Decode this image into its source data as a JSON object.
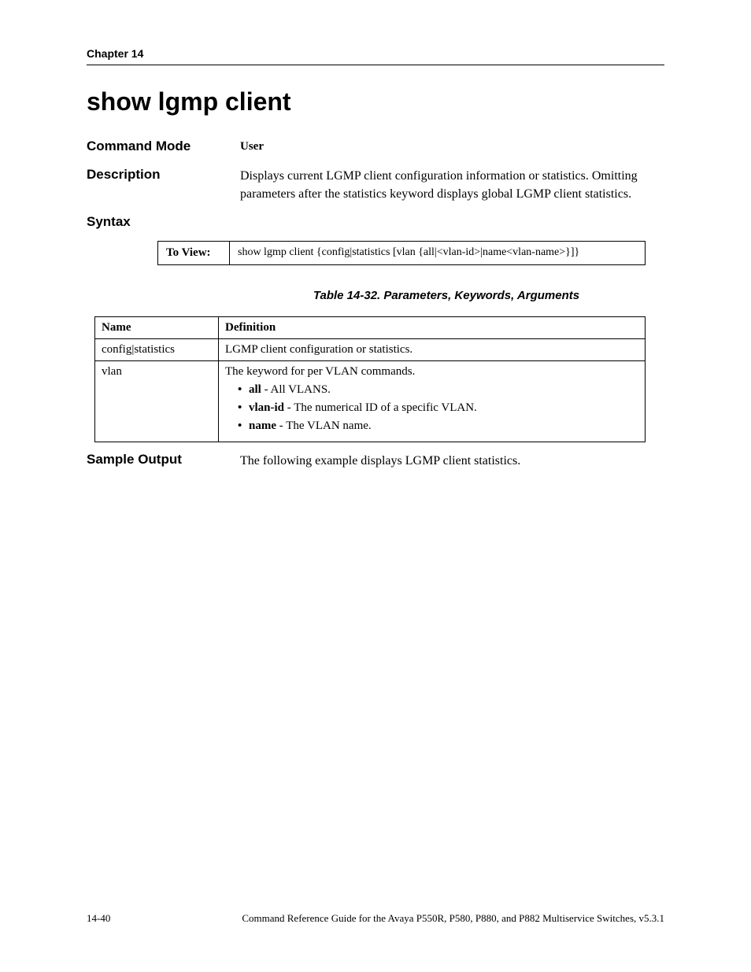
{
  "header": {
    "chapter": "Chapter 14"
  },
  "title": "show lgmp client",
  "command_mode": {
    "label": "Command Mode",
    "value": "User"
  },
  "description": {
    "label": "Description",
    "text": "Displays current LGMP client configuration information or statistics. Omitting parameters after the statistics keyword displays global LGMP client statistics."
  },
  "syntax": {
    "label": "Syntax",
    "row_label": "To View:",
    "command": "show lgmp client {config|statistics [vlan {all|<vlan-id>|name<vlan-name>}]}"
  },
  "table_caption": "Table 14-32.  Parameters, Keywords, Arguments",
  "params": {
    "headers": {
      "name": "Name",
      "definition": "Definition"
    },
    "rows": [
      {
        "name": "config|statistics",
        "def": "LGMP client configuration or statistics."
      },
      {
        "name": "vlan",
        "def": "The keyword for per VLAN commands.",
        "bullets": [
          {
            "term": "all",
            "text": " - All VLANS."
          },
          {
            "term": "vlan-id",
            "text": " - The numerical ID of a specific VLAN."
          },
          {
            "term": "name",
            "text": " - The VLAN name."
          }
        ]
      }
    ]
  },
  "sample_output": {
    "label": "Sample Output",
    "text": "The following example displays LGMP client statistics."
  },
  "footer": {
    "page": "14-40",
    "doc": "Command Reference Guide for the Avaya P550R, P580, P880, and P882 Multiservice Switches, v5.3.1"
  }
}
